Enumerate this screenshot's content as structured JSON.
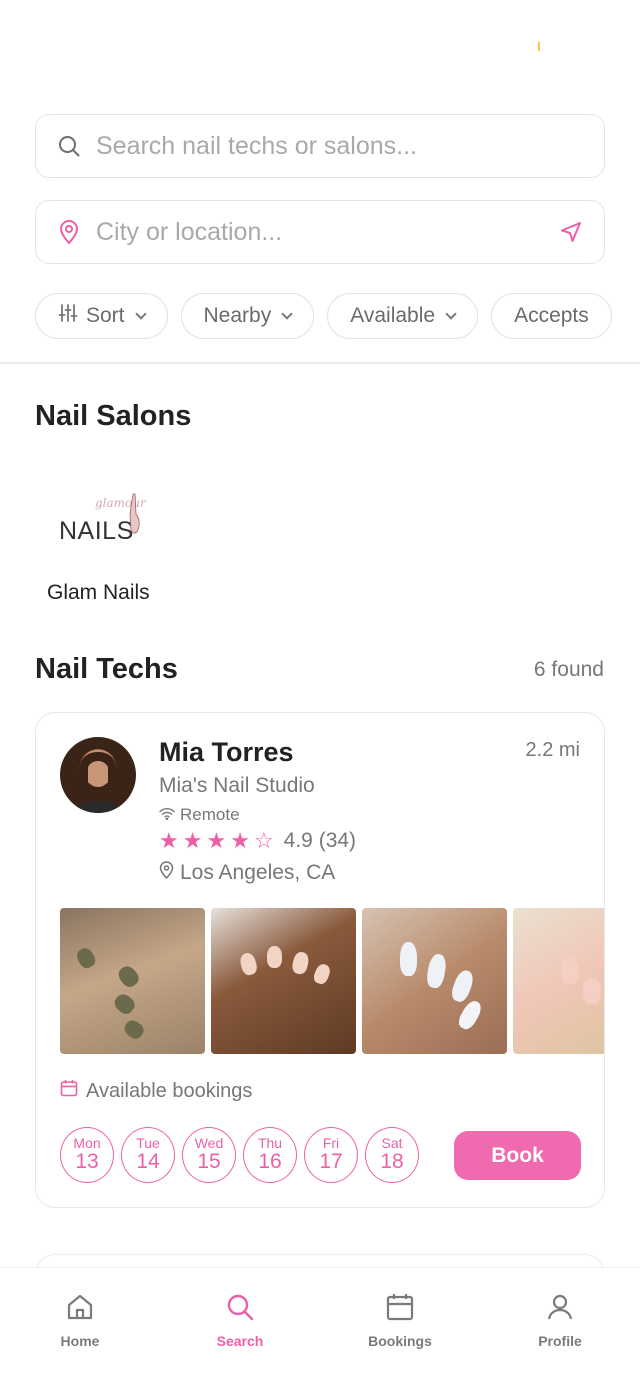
{
  "search": {
    "placeholder": "Search nail techs or salons..."
  },
  "location": {
    "placeholder": "City or location..."
  },
  "filters": [
    {
      "label": "Sort"
    },
    {
      "label": "Nearby"
    },
    {
      "label": "Available"
    },
    {
      "label": "Accepts"
    }
  ],
  "salons": {
    "title": "Nail Salons",
    "items": [
      {
        "name": "Glam Nails",
        "logo_script": "glamour",
        "logo_text": "NAILS"
      }
    ]
  },
  "techs": {
    "title": "Nail Techs",
    "count_label": "6 found",
    "items": [
      {
        "name": "Mia Torres",
        "distance": "2.2 mi",
        "studio": "Mia's Nail Studio",
        "mode": "Remote",
        "rating": 4.9,
        "rating_text": "4.9 (34)",
        "location": "Los Angeles, CA",
        "availability_label": "Available bookings",
        "days": [
          {
            "name": "Mon",
            "date": "13"
          },
          {
            "name": "Tue",
            "date": "14"
          },
          {
            "name": "Wed",
            "date": "15"
          },
          {
            "name": "Thu",
            "date": "16"
          },
          {
            "name": "Fri",
            "date": "17"
          },
          {
            "name": "Sat",
            "date": "18"
          }
        ],
        "book_label": "Book"
      }
    ]
  },
  "tabbar": {
    "home": "Home",
    "search": "Search",
    "bookings": "Bookings",
    "profile": "Profile"
  },
  "colors": {
    "accent": "#ee5fa7",
    "book_button": "#ef6aaf",
    "muted": "#777777"
  }
}
